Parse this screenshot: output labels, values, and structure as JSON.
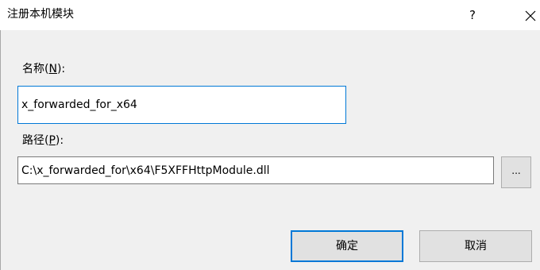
{
  "window": {
    "title": "注册本机模块",
    "help_label": "?"
  },
  "form": {
    "name_label_prefix": "名称(",
    "name_label_key": "N",
    "name_label_suffix": "):",
    "name_value": "x_forwarded_for_x64",
    "path_label_prefix": "路径(",
    "path_label_key": "P",
    "path_label_suffix": "):",
    "path_value": "C:\\x_forwarded_for\\x64\\F5XFFHttpModule.dll",
    "browse_label": "..."
  },
  "buttons": {
    "ok_label": "确定",
    "cancel_label": "取消"
  },
  "icons": {
    "close": "close-icon"
  },
  "colors": {
    "focus_accent": "#0078d7",
    "dialog_background": "#f0f0f0",
    "button_face": "#e1e1e1"
  }
}
